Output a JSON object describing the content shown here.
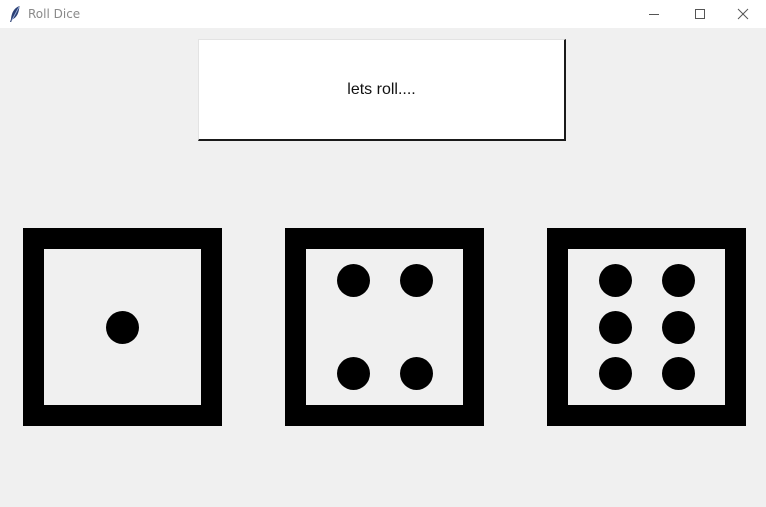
{
  "window": {
    "title": "Roll Dice",
    "controls": {
      "minimize": "minimize-icon",
      "maximize": "maximize-icon",
      "close": "close-icon"
    }
  },
  "roll_button": {
    "label": "lets roll...."
  },
  "dice": [
    {
      "value": 1
    },
    {
      "value": 4
    },
    {
      "value": 6
    }
  ],
  "colors": {
    "background": "#f0f0f0",
    "die_border": "#000000",
    "pip": "#000000",
    "label_background": "#ffffff"
  }
}
